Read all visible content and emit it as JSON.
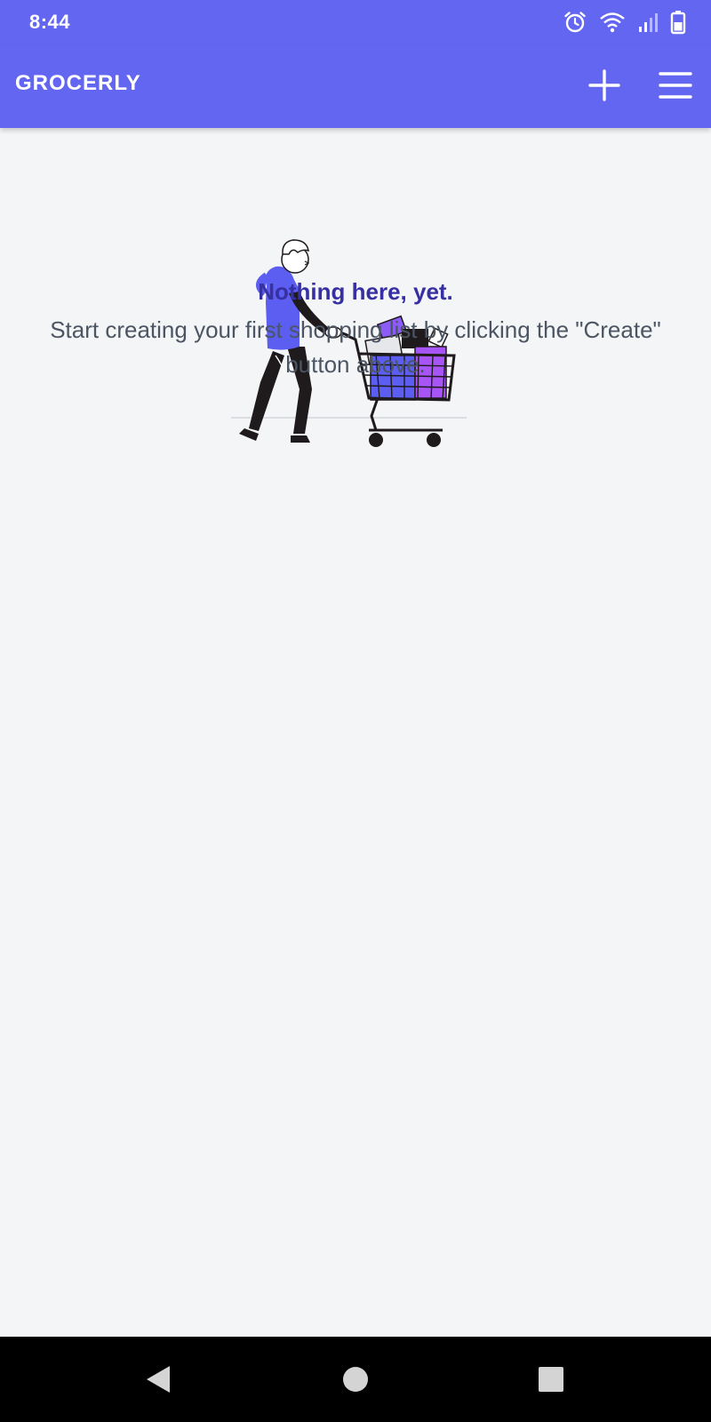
{
  "status": {
    "time": "8:44",
    "icons": [
      "alarm-icon",
      "wifi-icon",
      "signal-icon",
      "battery-icon"
    ]
  },
  "appbar": {
    "title": "GROCERLY",
    "actions": [
      "plus-icon",
      "menu-icon"
    ],
    "color": "#6366f1"
  },
  "empty_state": {
    "title": "Nothing here, yet.",
    "description": "Start creating your first shopping list by clicking the \"Create\" button above.",
    "title_color": "#3730a3"
  },
  "navbar": {
    "icons": [
      "back-icon",
      "home-icon",
      "recents-icon"
    ]
  }
}
